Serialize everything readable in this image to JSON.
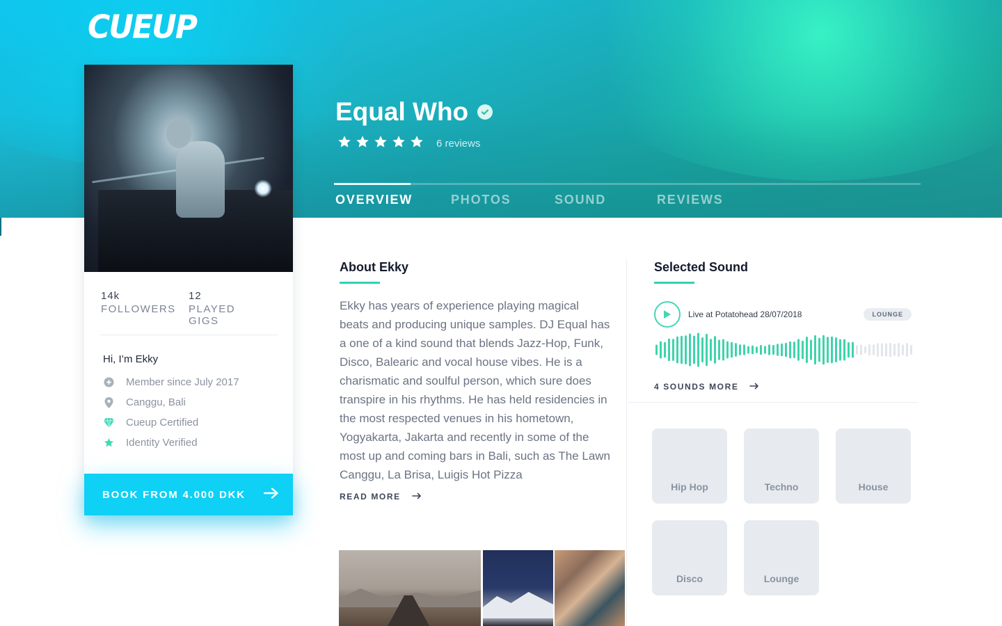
{
  "brand": {
    "logo_text": "CUEUP"
  },
  "profile": {
    "name": "Equal Who",
    "verified": true,
    "rating": 5,
    "reviews_label": "6 reviews",
    "stats": [
      {
        "value": "14k",
        "label": "FOLLOWERS"
      },
      {
        "value": "12",
        "label": "PLAYED GIGS"
      }
    ],
    "greeting": "Hi, I’m Ekky",
    "info": [
      {
        "icon": "plus-circle-icon",
        "text": "Member since July 2017"
      },
      {
        "icon": "location-pin-icon",
        "text": "Canggu, Bali"
      },
      {
        "icon": "certified-gem-icon",
        "text": "Cueup Certified"
      },
      {
        "icon": "star-icon",
        "text": "Identity Verified"
      }
    ],
    "book_label": "BOOK FROM 4.000 DKK"
  },
  "tabs": [
    {
      "label": "OVERVIEW",
      "active": true
    },
    {
      "label": "PHOTOS",
      "active": false
    },
    {
      "label": "SOUND",
      "active": false
    },
    {
      "label": "REVIEWS",
      "active": false
    }
  ],
  "about": {
    "title": "About Ekky",
    "text": "Ekky has years of experience playing magical beats and producing unique samples. DJ Equal has a one of a kind sound that blends Jazz-Hop, Funk, Disco, Balearic and vocal house vibes. He is a charismatic and soulful person, which sure does transpire in his rhythms. He has held residencies in the most respected venues in his hometown, Yogyakarta, Jakarta and recently in some of the most up and coming bars in Bali, such as The Lawn Canggu, La Brisa, Luigis Hot Pizza",
    "read_more": "READ MORE"
  },
  "sound": {
    "title": "Selected Sound",
    "track": "Live at Potatohead 28/07/2018",
    "genre_badge": "LOUNGE",
    "more_label": "4 SOUNDS MORE",
    "progress": 0.78
  },
  "genres": [
    "Hip Hop",
    "Techno",
    "House",
    "Disco",
    "Lounge"
  ],
  "colors": {
    "accent": "#0fd0f5",
    "teal": "#2fd1b3",
    "wave_played": "#3ed3ac",
    "wave_unplayed": "#e2e6ea"
  }
}
